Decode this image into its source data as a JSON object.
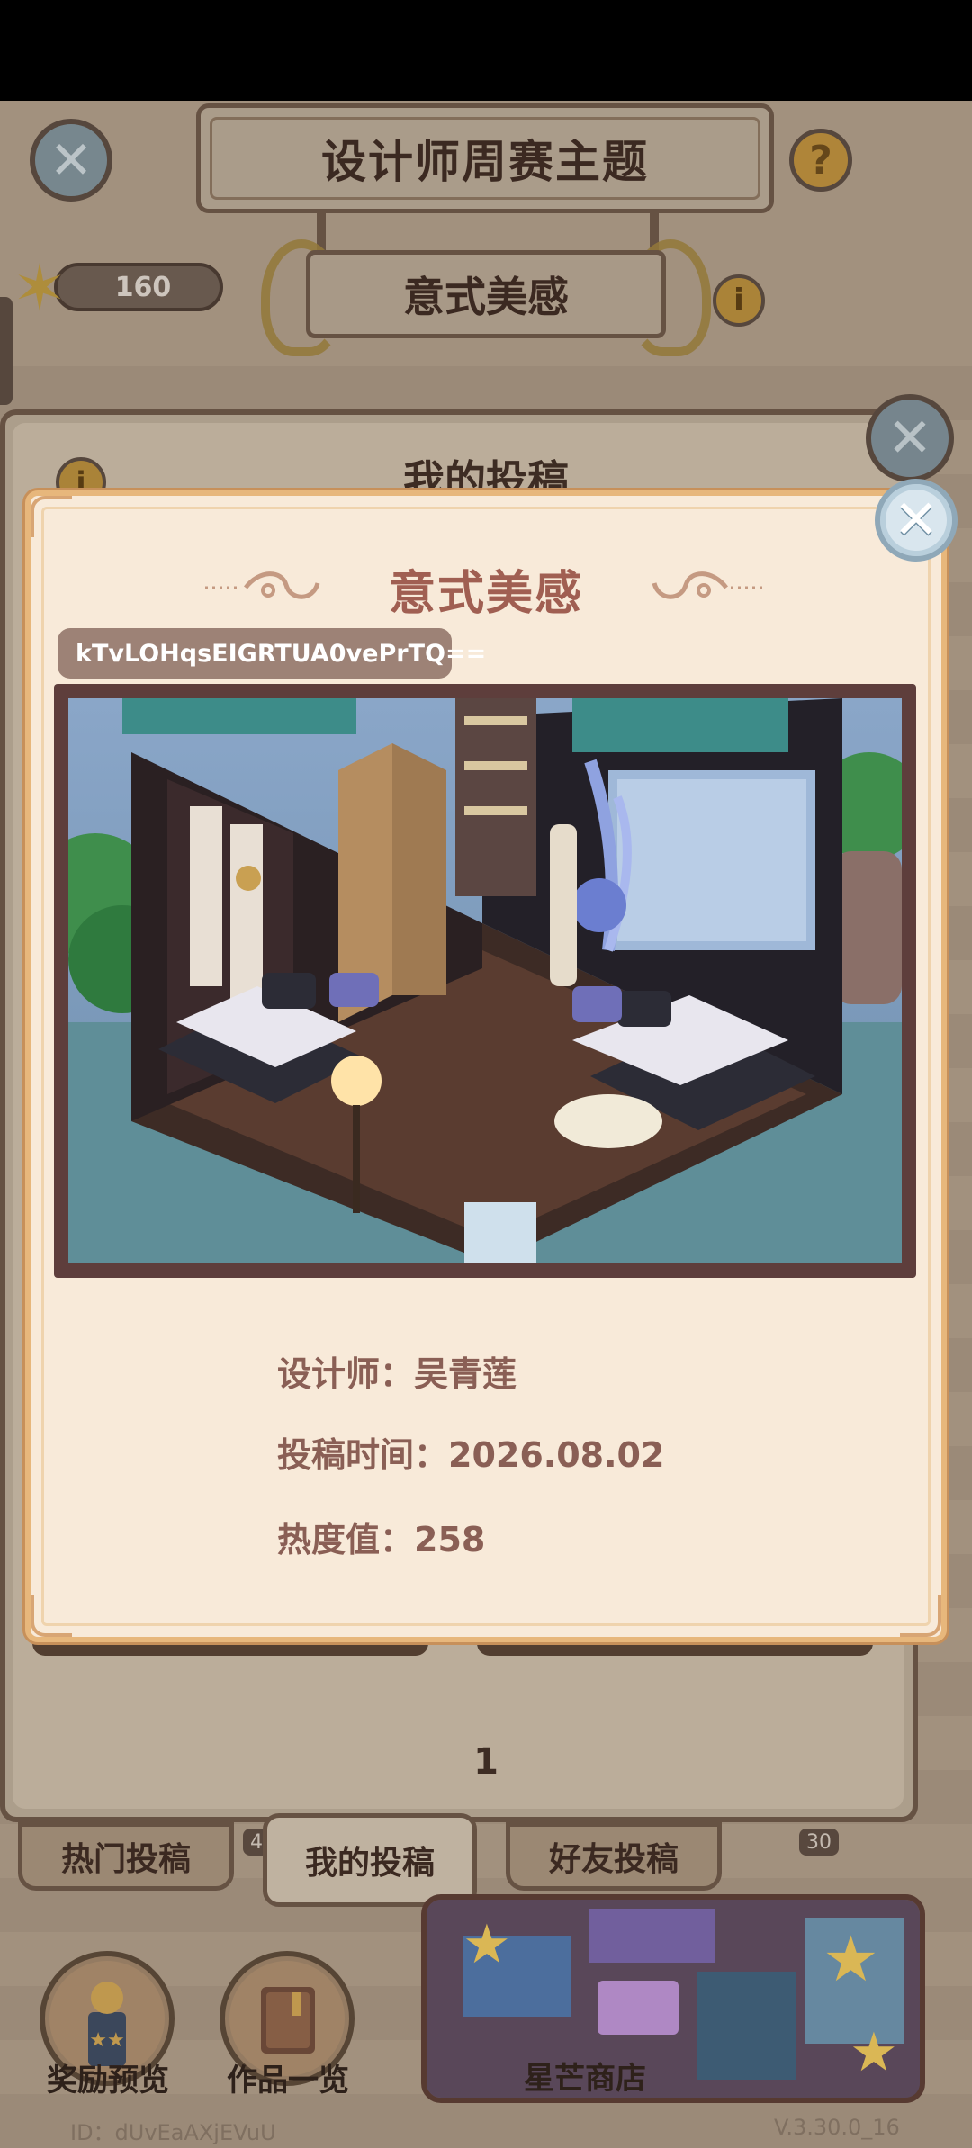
{
  "header": {
    "title": "设计师周赛主题",
    "theme": "意式美感",
    "star_count": "160"
  },
  "panel": {
    "title": "我的投稿",
    "page_number": "1"
  },
  "tabs": [
    {
      "label": "热门投稿"
    },
    {
      "label": "我的投稿"
    },
    {
      "label": "好友投稿"
    }
  ],
  "tab_badges": {
    "left": "4",
    "right": "30"
  },
  "bottom_bar": {
    "reward_preview": "奖励预览",
    "works_overview": "作品一览",
    "shop": "星芒商店"
  },
  "footer": {
    "player_id": "ID：dUvEaAXjEVuU",
    "version": "V.3.30.0_16"
  },
  "modal": {
    "title": "意式美感",
    "code": "kTvLOHqsEIGRTUA0vePrTQ==",
    "designer_label": "设计师：",
    "designer_value": "吴青莲",
    "submit_time_label": "投稿时间：",
    "submit_time_value": "2026.08.02",
    "heat_label": "热度值：",
    "heat_value": "258"
  },
  "icons": {
    "close": "close-icon",
    "help": "question-icon",
    "info": "info-icon",
    "star": "star-icon"
  },
  "colors": {
    "modal_bg": "#f8ead9",
    "modal_border": "#e7b77c",
    "title_text": "#a05f52",
    "info_text": "#8a5f55",
    "code_pill": "#9d8276"
  }
}
